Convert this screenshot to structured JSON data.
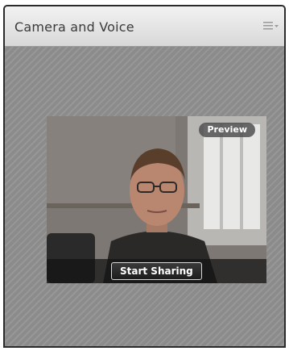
{
  "panel": {
    "title": "Camera and Voice",
    "menu_icon": "hamburger-menu-icon"
  },
  "video": {
    "badge": "Preview",
    "share_button_label": "Start Sharing"
  }
}
